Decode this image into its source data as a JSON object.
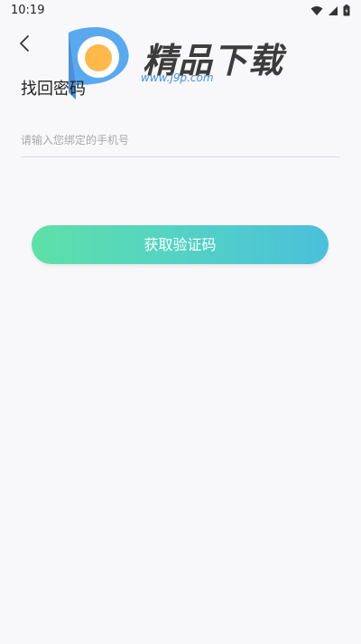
{
  "status_bar": {
    "time": "10:19"
  },
  "watermark": {
    "brand_text": "精品下载",
    "url_text": "www.j9p.com"
  },
  "page": {
    "title": "找回密码",
    "phone_input": {
      "placeholder": "请输入您绑定的手机号",
      "value": ""
    },
    "get_code_button_label": "获取验证码"
  },
  "colors": {
    "button_gradient_start": "#5ee0a8",
    "button_gradient_end": "#4ac0da",
    "background": "#f8f8fa"
  },
  "icons": [
    "wifi-icon",
    "signal-icon",
    "battery-icon",
    "back-arrow-icon"
  ]
}
